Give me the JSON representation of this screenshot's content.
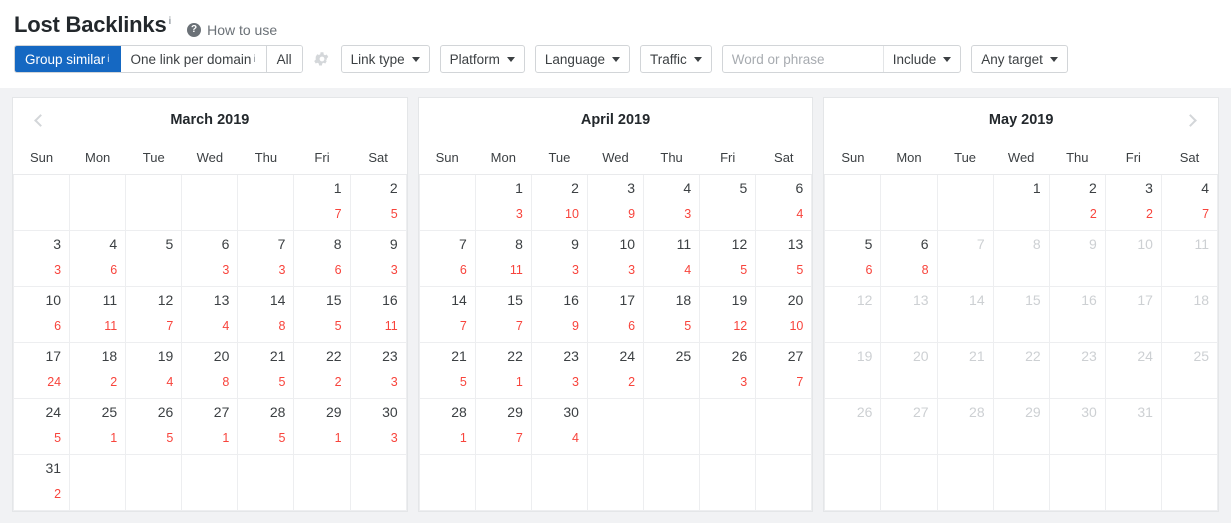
{
  "header": {
    "title": "Lost Backlinks",
    "title_sup": "i",
    "howto_label": "How to use",
    "help_glyph": "?"
  },
  "toolbar": {
    "segments": [
      {
        "label": "Group similar",
        "sup": "i",
        "active": true
      },
      {
        "label": "One link per domain",
        "sup": "i",
        "active": false
      },
      {
        "label": "All",
        "sup": "",
        "active": false
      }
    ],
    "gear_name": "gear-icon",
    "dropdowns": [
      {
        "label": "Link type"
      },
      {
        "label": "Platform"
      },
      {
        "label": "Language"
      },
      {
        "label": "Traffic"
      }
    ],
    "search": {
      "placeholder": "Word or phrase",
      "value": "",
      "mode_label": "Include"
    },
    "target": {
      "label": "Any target"
    }
  },
  "accent_colors": {
    "primary_blue": "#1568c2",
    "count_red": "#f8443c",
    "selection_fill": "#e9f2fc",
    "selection_border": "#9cc6ee",
    "muted_text": "#cdd0d3"
  },
  "weekdays": [
    "Sun",
    "Mon",
    "Tue",
    "Wed",
    "Thu",
    "Fri",
    "Sat"
  ],
  "calendars": [
    {
      "title": "March 2019",
      "prev_arrow": true,
      "next_arrow": false,
      "weeks": [
        [
          {
            "blank": true
          },
          {
            "blank": true
          },
          {
            "blank": true
          },
          {
            "blank": true
          },
          {
            "blank": true
          },
          {
            "day": "1",
            "count": "7"
          },
          {
            "day": "2",
            "count": "5"
          }
        ],
        [
          {
            "day": "3",
            "count": "3"
          },
          {
            "day": "4",
            "count": "6"
          },
          {
            "day": "5",
            "count": ""
          },
          {
            "day": "6",
            "count": "3"
          },
          {
            "day": "7",
            "count": "3"
          },
          {
            "day": "8",
            "count": "6"
          },
          {
            "day": "9",
            "count": "3"
          }
        ],
        [
          {
            "day": "10",
            "count": "6"
          },
          {
            "day": "11",
            "count": "11"
          },
          {
            "day": "12",
            "count": "7"
          },
          {
            "day": "13",
            "count": "4"
          },
          {
            "day": "14",
            "count": "8"
          },
          {
            "day": "15",
            "count": "5"
          },
          {
            "day": "16",
            "count": "11"
          }
        ],
        [
          {
            "day": "17",
            "count": "24"
          },
          {
            "day": "18",
            "count": "2"
          },
          {
            "day": "19",
            "count": "4"
          },
          {
            "day": "20",
            "count": "8"
          },
          {
            "day": "21",
            "count": "5"
          },
          {
            "day": "22",
            "count": "2"
          },
          {
            "day": "23",
            "count": "3"
          }
        ],
        [
          {
            "day": "24",
            "count": "5"
          },
          {
            "day": "25",
            "count": "1"
          },
          {
            "day": "26",
            "count": "5"
          },
          {
            "day": "27",
            "count": "1"
          },
          {
            "day": "28",
            "count": "5"
          },
          {
            "day": "29",
            "count": "1"
          },
          {
            "day": "30",
            "count": "3"
          }
        ],
        [
          {
            "day": "31",
            "count": "2"
          },
          {
            "blank": true
          },
          {
            "blank": true
          },
          {
            "blank": true
          },
          {
            "blank": true
          },
          {
            "blank": true
          },
          {
            "blank": true
          }
        ]
      ]
    },
    {
      "title": "April 2019",
      "prev_arrow": false,
      "next_arrow": false,
      "weeks": [
        [
          {
            "blank": true
          },
          {
            "day": "1",
            "count": "3"
          },
          {
            "day": "2",
            "count": "10"
          },
          {
            "day": "3",
            "count": "9"
          },
          {
            "day": "4",
            "count": "3"
          },
          {
            "day": "5",
            "count": ""
          },
          {
            "day": "6",
            "count": "4"
          }
        ],
        [
          {
            "day": "7",
            "count": "6"
          },
          {
            "day": "8",
            "count": "11"
          },
          {
            "day": "9",
            "count": "3"
          },
          {
            "day": "10",
            "count": "3"
          },
          {
            "day": "11",
            "count": "4"
          },
          {
            "day": "12",
            "count": "5"
          },
          {
            "day": "13",
            "count": "5"
          }
        ],
        [
          {
            "day": "14",
            "count": "7"
          },
          {
            "day": "15",
            "count": "7"
          },
          {
            "day": "16",
            "count": "9"
          },
          {
            "day": "17",
            "count": "6"
          },
          {
            "day": "18",
            "count": "5"
          },
          {
            "day": "19",
            "count": "12"
          },
          {
            "day": "20",
            "count": "10"
          }
        ],
        [
          {
            "day": "21",
            "count": "5"
          },
          {
            "day": "22",
            "count": "1"
          },
          {
            "day": "23",
            "count": "3"
          },
          {
            "day": "24",
            "count": "2"
          },
          {
            "day": "25",
            "count": ""
          },
          {
            "day": "26",
            "count": "3"
          },
          {
            "day": "27",
            "count": "7"
          }
        ],
        [
          {
            "day": "28",
            "count": "1"
          },
          {
            "day": "29",
            "count": "7"
          },
          {
            "day": "30",
            "count": "4",
            "selected": true,
            "sel_top": true,
            "sel_bottom": true,
            "sel_left": true,
            "sel_right": true
          },
          {
            "blank": true
          },
          {
            "blank": true
          },
          {
            "blank": true
          },
          {
            "blank": true
          }
        ],
        [
          {
            "blank": true
          },
          {
            "blank": true
          },
          {
            "blank": true
          },
          {
            "blank": true
          },
          {
            "blank": true
          },
          {
            "blank": true
          },
          {
            "blank": true
          }
        ]
      ]
    },
    {
      "title": "May 2019",
      "prev_arrow": false,
      "next_arrow": true,
      "weeks": [
        [
          {
            "blank": true
          },
          {
            "blank": true
          },
          {
            "blank": true
          },
          {
            "day": "1",
            "count": "",
            "selected": true,
            "sel_top": true,
            "sel_bottom": true,
            "sel_left": true
          },
          {
            "day": "2",
            "count": "2",
            "selected": true,
            "sel_top": true,
            "sel_bottom": true
          },
          {
            "day": "3",
            "count": "2",
            "selected": true,
            "sel_top": true,
            "sel_bottom": true
          },
          {
            "day": "4",
            "count": "7",
            "selected": true,
            "sel_top": true,
            "sel_bottom": true,
            "sel_right": true
          }
        ],
        [
          {
            "day": "5",
            "count": "6",
            "selected": true,
            "sel_top": true,
            "sel_bottom": true,
            "sel_left": true
          },
          {
            "day": "6",
            "count": "8",
            "selected": true,
            "sel_top": true,
            "sel_bottom": true,
            "sel_right": true
          },
          {
            "day": "7",
            "count": "",
            "muted": true
          },
          {
            "day": "8",
            "count": "",
            "muted": true
          },
          {
            "day": "9",
            "count": "",
            "muted": true
          },
          {
            "day": "10",
            "count": "",
            "muted": true
          },
          {
            "day": "11",
            "count": "",
            "muted": true
          }
        ],
        [
          {
            "day": "12",
            "count": "",
            "muted": true
          },
          {
            "day": "13",
            "count": "",
            "muted": true
          },
          {
            "day": "14",
            "count": "",
            "muted": true
          },
          {
            "day": "15",
            "count": "",
            "muted": true
          },
          {
            "day": "16",
            "count": "",
            "muted": true
          },
          {
            "day": "17",
            "count": "",
            "muted": true
          },
          {
            "day": "18",
            "count": "",
            "muted": true
          }
        ],
        [
          {
            "day": "19",
            "count": "",
            "muted": true
          },
          {
            "day": "20",
            "count": "",
            "muted": true
          },
          {
            "day": "21",
            "count": "",
            "muted": true
          },
          {
            "day": "22",
            "count": "",
            "muted": true
          },
          {
            "day": "23",
            "count": "",
            "muted": true
          },
          {
            "day": "24",
            "count": "",
            "muted": true
          },
          {
            "day": "25",
            "count": "",
            "muted": true
          }
        ],
        [
          {
            "day": "26",
            "count": "",
            "muted": true
          },
          {
            "day": "27",
            "count": "",
            "muted": true
          },
          {
            "day": "28",
            "count": "",
            "muted": true
          },
          {
            "day": "29",
            "count": "",
            "muted": true
          },
          {
            "day": "30",
            "count": "",
            "muted": true
          },
          {
            "day": "31",
            "count": "",
            "muted": true
          },
          {
            "blank": true
          }
        ],
        [
          {
            "blank": true
          },
          {
            "blank": true
          },
          {
            "blank": true
          },
          {
            "blank": true
          },
          {
            "blank": true
          },
          {
            "blank": true
          },
          {
            "blank": true
          }
        ]
      ]
    }
  ]
}
